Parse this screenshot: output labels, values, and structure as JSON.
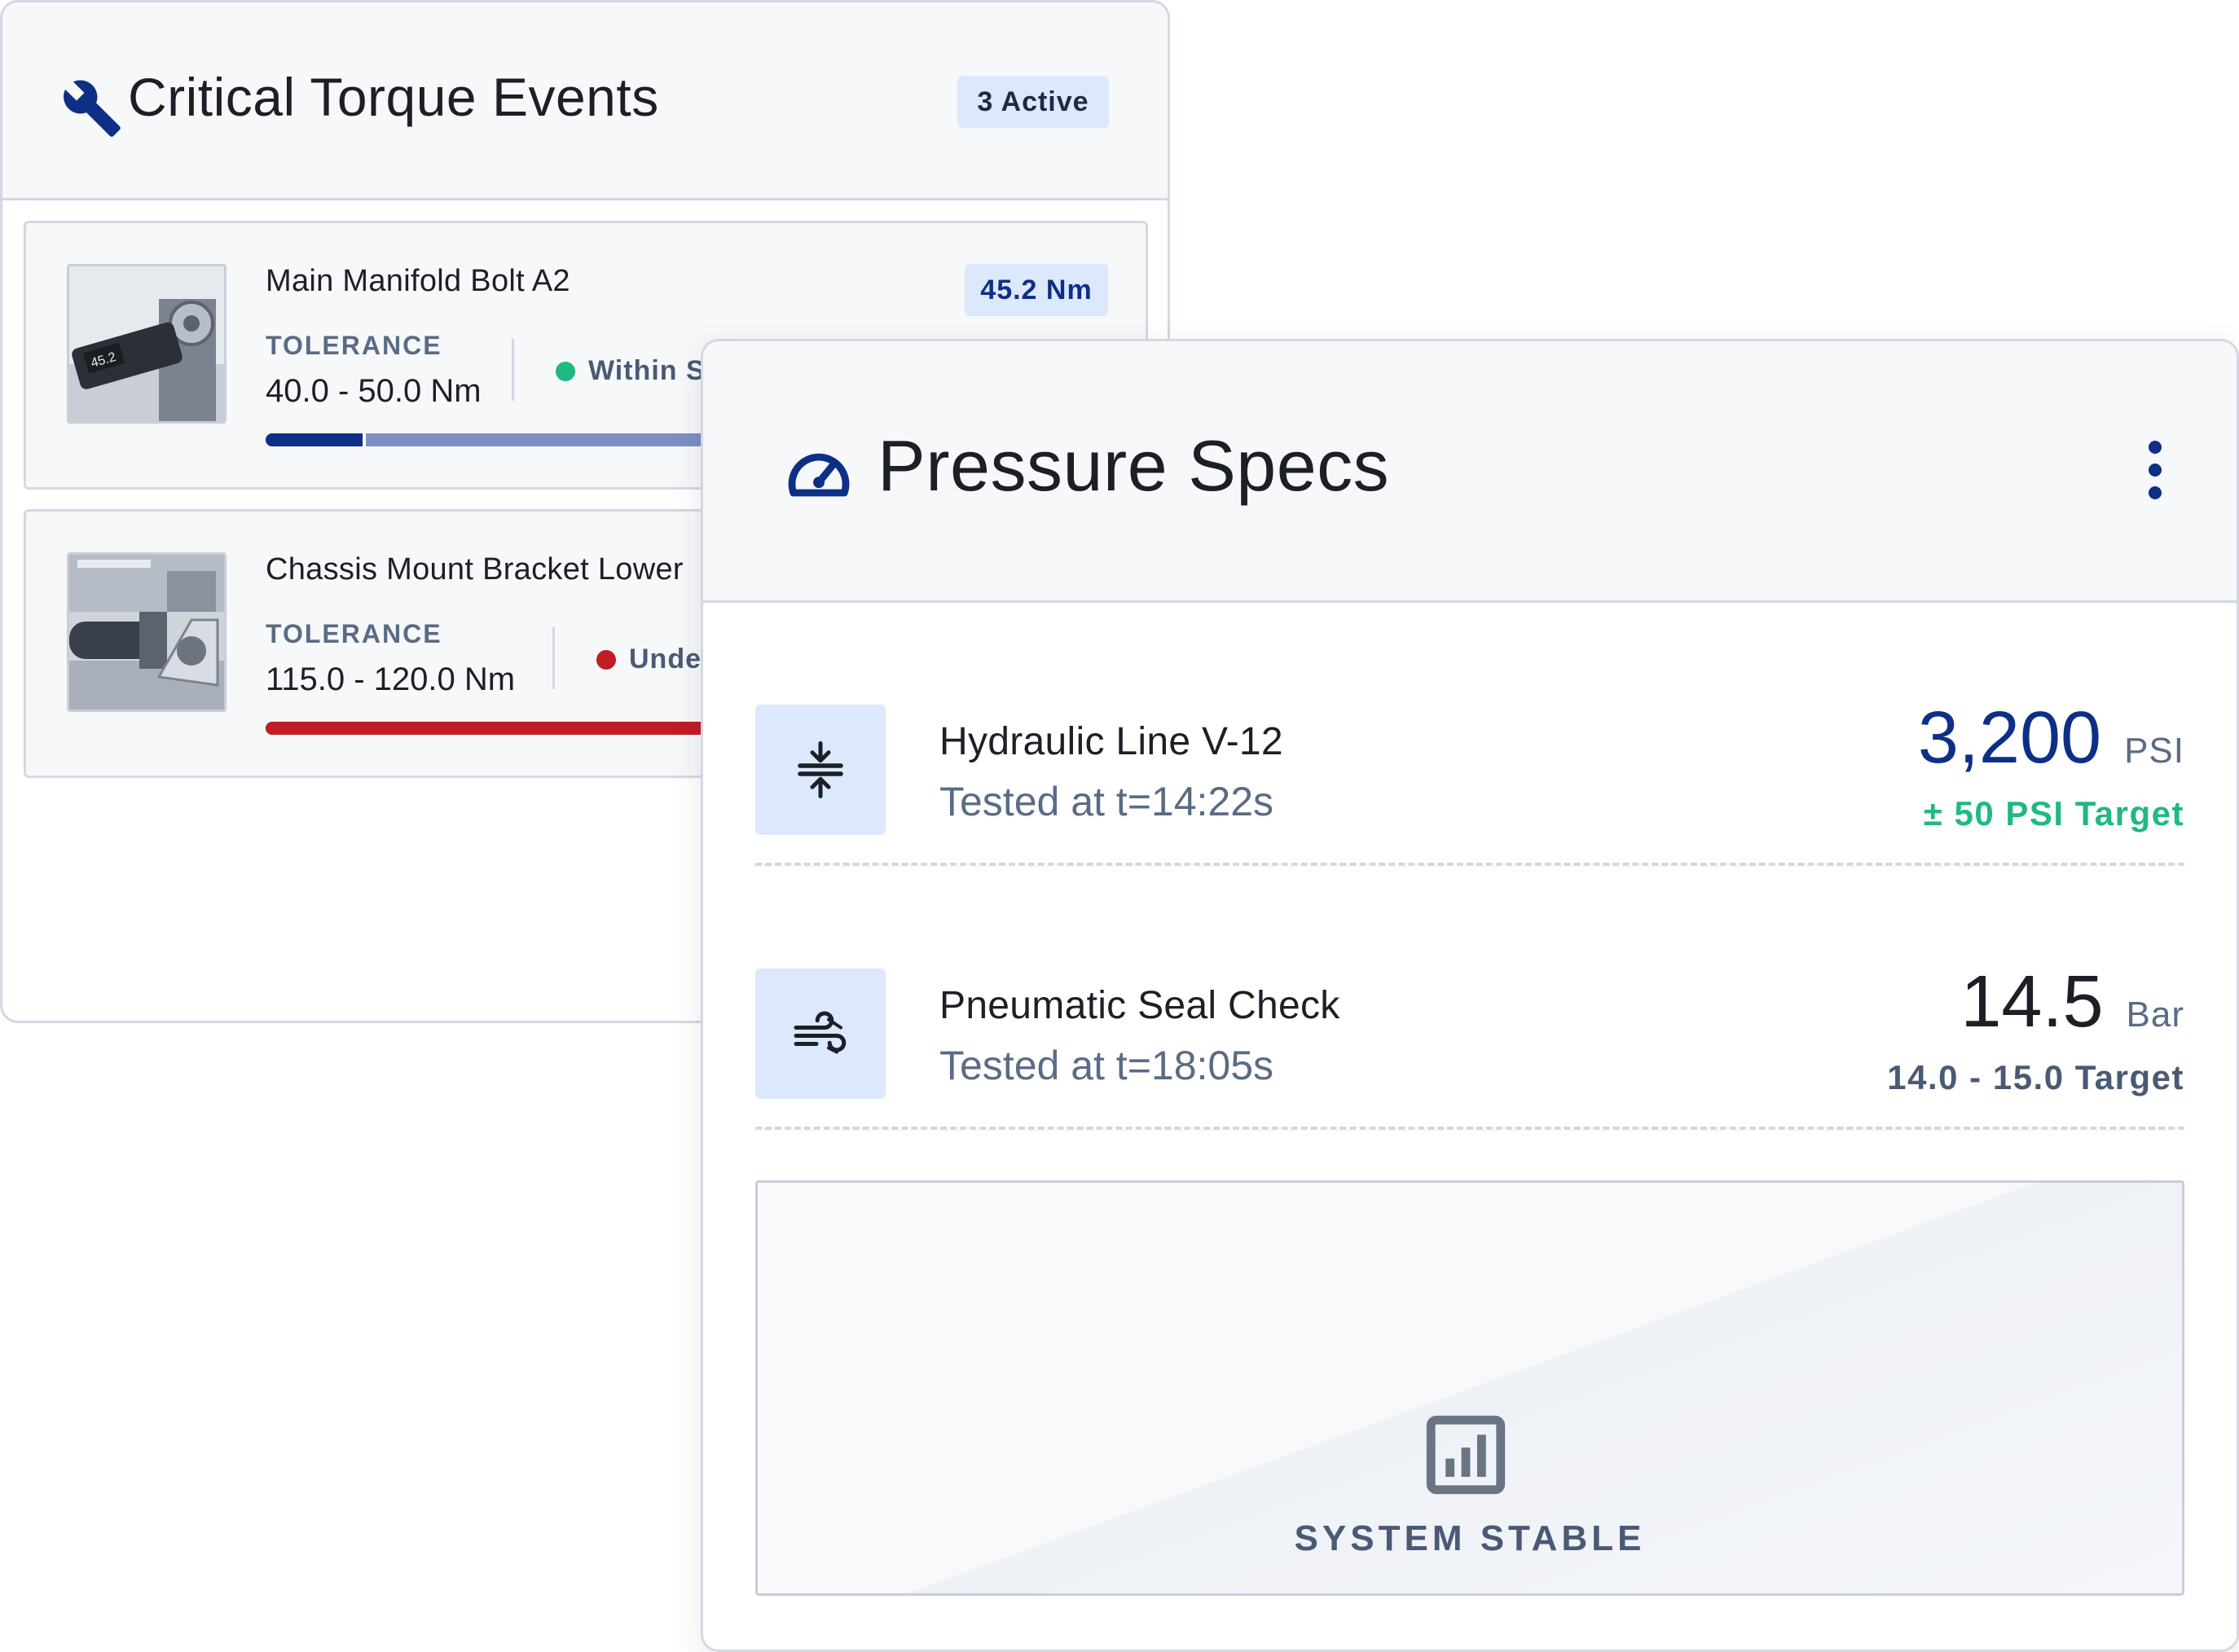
{
  "torque_card": {
    "title": "Critical Torque Events",
    "active_badge": "3 Active",
    "events": [
      {
        "name": "Main Manifold Bolt A2",
        "tolerance_label": "TOLERANCE",
        "tolerance_value": "40.0 - 50.0 Nm",
        "status": "Within Sp",
        "status_color": "#1fb982",
        "reading": "45.2 Nm",
        "bar_fill_fraction": 0.115,
        "bar_color": "#0e2f86",
        "bar_track_color": "#7d8fc4"
      },
      {
        "name": "Chassis Mount Bracket Lower",
        "tolerance_label": "TOLERANCE",
        "tolerance_value": "115.0 - 120.0 Nm",
        "status": "Under",
        "status_color": "#c01d24",
        "bar_fill_fraction": 1.0,
        "bar_color": "#c01d24"
      }
    ]
  },
  "pressure_card": {
    "title": "Pressure Specs",
    "menu_icon": "more-vertical-icon",
    "specs": [
      {
        "icon": "compress-arrows-icon",
        "name": "Hydraulic Line V-12",
        "tested": "Tested at t=14:22s",
        "value": "3,200",
        "unit": "PSI",
        "target": "± 50 PSI Target",
        "value_color": "#0e2f86",
        "target_color": "#1fb982"
      },
      {
        "icon": "wind-icon",
        "name": "Pneumatic Seal Check",
        "tested": "Tested at t=18:05s",
        "value": "14.5",
        "unit": "Bar",
        "target": "14.0 - 15.0 Target",
        "value_color": "#1c1f26",
        "target_color": "#4a5a75"
      }
    ],
    "stable_panel": {
      "icon": "bar-chart-icon",
      "label": "SYSTEM STABLE"
    }
  },
  "colors": {
    "brand_blue": "#0e2f86",
    "badge_bg": "#dce8fb",
    "success": "#1fb982",
    "danger": "#c01d24"
  }
}
